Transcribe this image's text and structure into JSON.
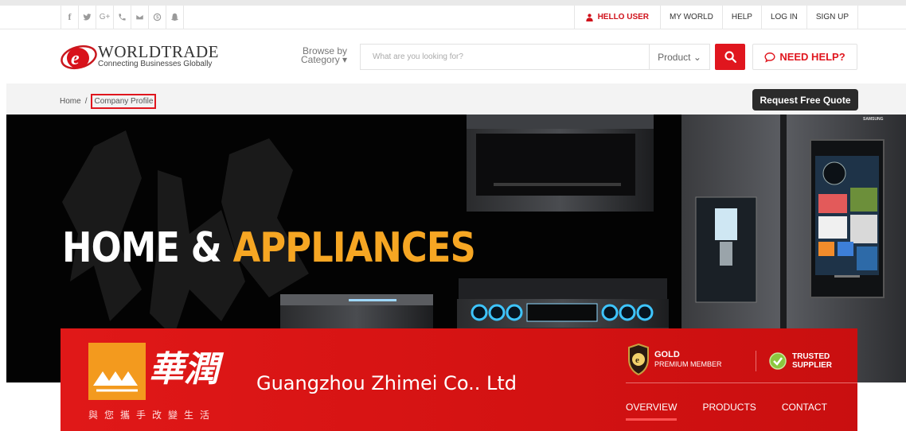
{
  "topbar": {
    "social_icons": [
      "facebook-icon",
      "twitter-icon",
      "google-plus-icon",
      "phone-icon",
      "mail-icon",
      "skype-icon",
      "snapchat-icon"
    ],
    "social_glyphs": {
      "facebook": "f",
      "google_plus": "G+"
    },
    "nav": {
      "hello_user": "HELLO USER",
      "my_world": "MY WORLD",
      "help": "HELP",
      "log_in": "LOG IN",
      "sign_up": "SIGN UP"
    }
  },
  "header": {
    "logo_title": "WORLDTRADE",
    "logo_tagline": "Connecting Businesses Globally",
    "browse_line1": "Browse by",
    "browse_line2": "Category ▾",
    "search_placeholder": "What are you looking for?",
    "search_value": "",
    "product_select": "Product ⌄",
    "need_help": "NEED HELP?"
  },
  "breadcrumb": {
    "home": "Home",
    "separator": "/",
    "current": "Company Profile",
    "request_quote": "Request Free Quote"
  },
  "banner": {
    "headline_white": "HOME & ",
    "headline_orange": "APPLIANCES",
    "brand_mark": "SAMSUNG"
  },
  "company": {
    "logo_chars": "華潤",
    "slogan": "與您攜手改變生活",
    "name": "Guangzhou Zhimei Co.. Ltd",
    "membership_line1": "GOLD",
    "membership_line2": "PREMIUM MEMBER",
    "trusted_line1": "TRUSTED",
    "trusted_line2": "SUPPLIER",
    "tabs": [
      "OVERVIEW",
      "PRODUCTS",
      "CONTACT"
    ],
    "active_tab": "OVERVIEW"
  },
  "colors": {
    "brand_red": "#e0161e",
    "company_red": "#d31212",
    "accent_orange": "#f6a623",
    "dark_button": "#2b2b2b",
    "logo_orange": "#f39a1e",
    "trusted_green": "#8cc63f"
  }
}
